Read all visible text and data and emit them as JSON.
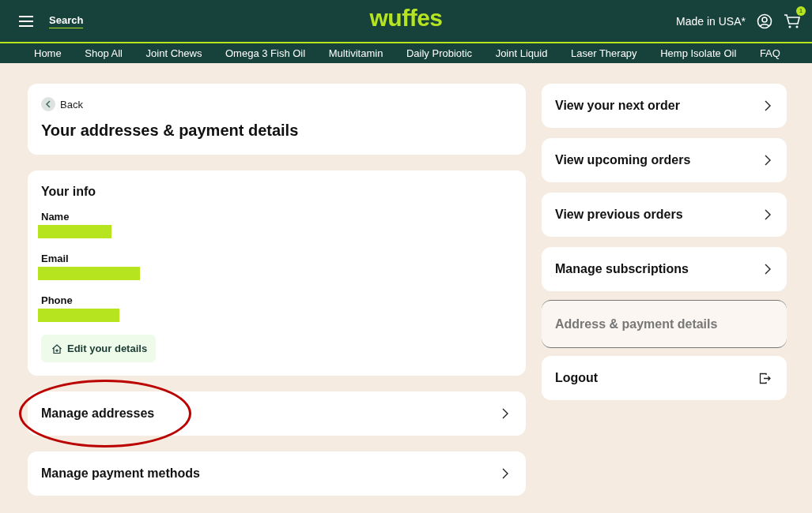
{
  "header": {
    "search": "Search",
    "logo": "wuffes",
    "made_in": "Made in USA*",
    "cart_count": "1"
  },
  "nav": [
    "Home",
    "Shop All",
    "Joint Chews",
    "Omega 3 Fish Oil",
    "Multivitamin",
    "Daily Probiotic",
    "Joint Liquid",
    "Laser Therapy",
    "Hemp Isolate Oil",
    "FAQ"
  ],
  "page": {
    "back": "Back",
    "title": "Your addresses & payment details"
  },
  "info": {
    "title": "Your info",
    "fields": [
      {
        "label": "Name",
        "redacted": true
      },
      {
        "label": "Email",
        "redacted": true
      },
      {
        "label": "Phone",
        "redacted": true
      }
    ],
    "edit_button": "Edit your details"
  },
  "links": [
    {
      "label": "Manage addresses",
      "circled": true
    },
    {
      "label": "Manage payment methods",
      "circled": false
    }
  ],
  "side_menu": [
    {
      "label": "View your next order",
      "kind": "link",
      "selected": false
    },
    {
      "label": "View upcoming orders",
      "kind": "link",
      "selected": false
    },
    {
      "label": "View previous orders",
      "kind": "link",
      "selected": false
    },
    {
      "label": "Manage subscriptions",
      "kind": "link",
      "selected": false
    },
    {
      "label": "Address & payment details",
      "selected": true
    },
    {
      "label": "Logout",
      "kind": "logout",
      "selected": false
    }
  ]
}
